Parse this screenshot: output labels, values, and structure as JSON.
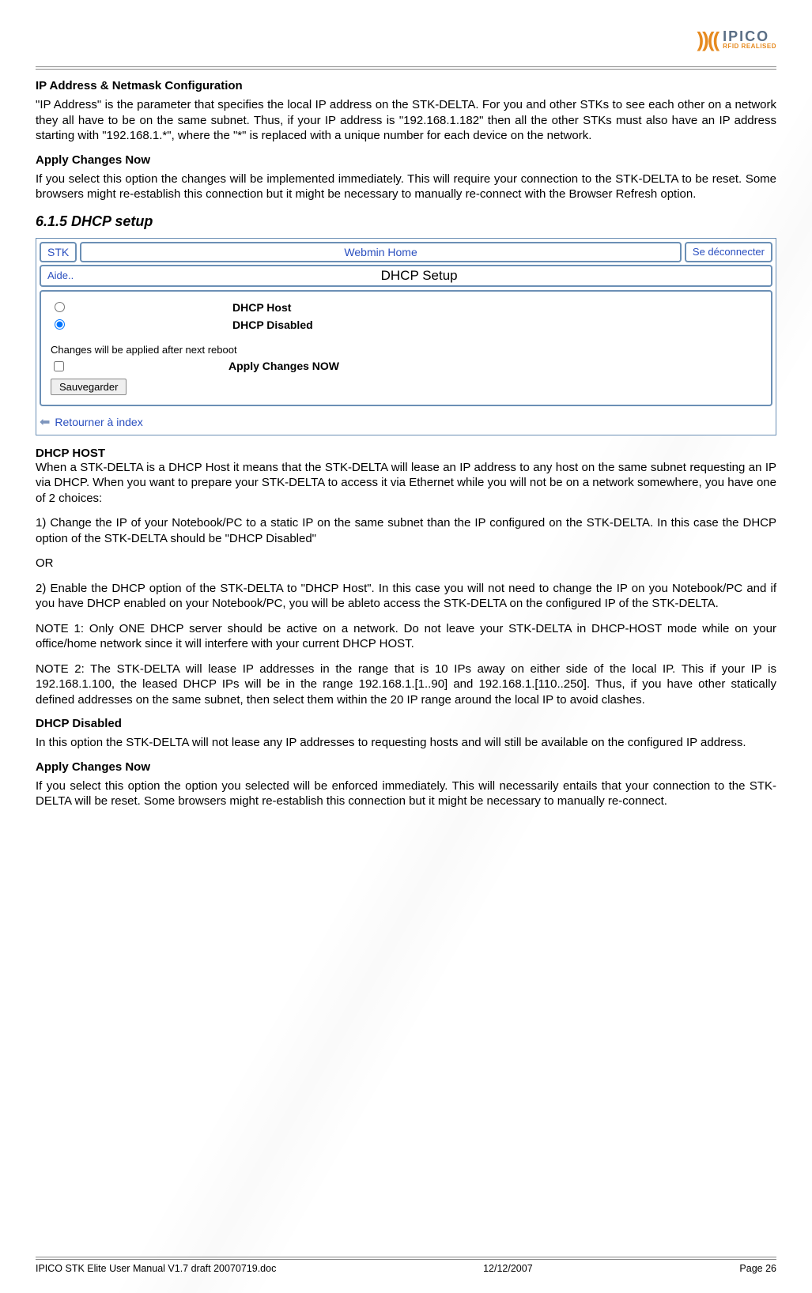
{
  "header": {
    "logo_name": "IPICO",
    "logo_tagline": "RFID REALISED"
  },
  "sections": {
    "ip_title": "IP Address & Netmask Configuration",
    "ip_body": "\"IP Address\" is the parameter that specifies the local IP address on the STK-DELTA. For you and other STKs to see each other on a network they all have to be on the same subnet. Thus, if your IP address is \"192.168.1.182\" then all the other STKs must also have an IP address starting with \"192.168.1.*\", where the \"*\" is replaced with a unique number for each device on the network.",
    "apply1_title": "Apply Changes Now",
    "apply1_body": "If you select this option the changes will be implemented immediately. This will require your connection to the STK-DELTA to be reset. Some browsers might re-establish this connection but it might be necessary to manually re-connect with the Browser Refresh option.",
    "dhcp_setup_heading": "6.1.5   DHCP setup",
    "dhcp_host_title": "DHCP HOST",
    "dhcp_host_body": "When a STK-DELTA is a DHCP Host it means that the STK-DELTA will lease an IP address to any host on the same subnet requesting an IP via DHCP. When you want to prepare your STK-DELTA to access it via Ethernet while you will not be on a network somewhere, you have one of 2 choices:",
    "option1": "1) Change the IP of your Notebook/PC to a static IP on the same subnet than the IP configured on the STK-DELTA. In this case the DHCP option of the STK-DELTA should be \"DHCP Disabled\"",
    "or": "OR",
    "option2": "2) Enable the DHCP option of the STK-DELTA to \"DHCP Host\". In this case you will not need to change the IP on you Notebook/PC and if you have DHCP enabled on your Notebook/PC, you will be ableto access the STK-DELTA on the configured IP of the STK-DELTA.",
    "note1": "NOTE 1: Only ONE DHCP server should be active on a network. Do not leave your STK-DELTA in DHCP-HOST mode while on your office/home network since it will interfere with your current DHCP HOST.",
    "note2": "NOTE 2: The STK-DELTA will lease IP addresses in the range that is 10 IPs away on either side of the local IP. This if your IP is 192.168.1.100, the leased DHCP IPs will be in the range 192.168.1.[1..90] and 192.168.1.[110..250]. Thus, if you have other statically defined addresses on the same subnet, then select them within the 20 IP range around the local IP to avoid clashes.",
    "dhcp_disabled_title": "DHCP Disabled",
    "dhcp_disabled_body": "In this option the STK-DELTA will not lease any IP addresses to requesting hosts and will still be available on the configured IP address.",
    "apply2_title": "Apply Changes Now",
    "apply2_body": "If you select this option the option you selected will be enforced immediately. This will necessarily entails that your connection to the STK-DELTA will be reset. Some browsers might re-establish this connection but it might be necessary to manually re-connect."
  },
  "webmin": {
    "stk_label": "STK",
    "home_label": "Webmin Home",
    "logout_label": "Se déconnecter",
    "aide_label": "Aide..",
    "page_title": "DHCP Setup",
    "radio_host": "DHCP Host",
    "radio_disabled": "DHCP Disabled",
    "radio_selected": "disabled",
    "reboot_note": "Changes will be applied after next reboot",
    "apply_now_label": "Apply Changes NOW",
    "save_button": "Sauvegarder",
    "return_link": "Retourner à index"
  },
  "footer": {
    "doc_name": "IPICO STK Elite User Manual V1.7 draft 20070719.doc",
    "date": "12/12/2007",
    "page": "Page 26"
  }
}
